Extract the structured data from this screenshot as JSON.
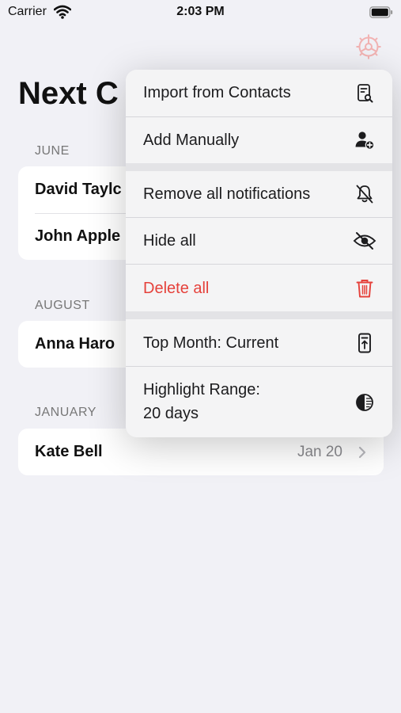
{
  "status_bar": {
    "carrier": "Carrier",
    "time": "2:03 PM"
  },
  "page_title": "Next C",
  "sections": [
    {
      "header": "JUNE",
      "rows": [
        {
          "name": "David Taylc"
        },
        {
          "name": "John Apple"
        }
      ]
    },
    {
      "header": "AUGUST",
      "rows": [
        {
          "name": "Anna Haro"
        }
      ]
    },
    {
      "header": "JANUARY",
      "rows": [
        {
          "name": "Kate Bell",
          "date": "Jan 20"
        }
      ]
    }
  ],
  "menu": {
    "items": [
      {
        "label": "Import from Contacts",
        "icon": "import-contacts-icon"
      },
      {
        "label": "Add Manually",
        "icon": "add-person-icon"
      },
      {
        "label": "Remove all notifications",
        "icon": "bell-slash-icon"
      },
      {
        "label": "Hide all",
        "icon": "eye-slash-icon"
      },
      {
        "label": "Delete all",
        "icon": "trash-icon"
      },
      {
        "label": "Top Month: Current",
        "icon": "calendar-top-icon"
      },
      {
        "label_line1": "Highlight Range:",
        "label_line2": "20 days",
        "icon": "half-circle-icon"
      }
    ]
  },
  "colors": {
    "destructive": "#e5413b",
    "gear_tint": "#f2b3b3",
    "label": "#1c1c1e",
    "secondary": "#8a8a8e"
  }
}
